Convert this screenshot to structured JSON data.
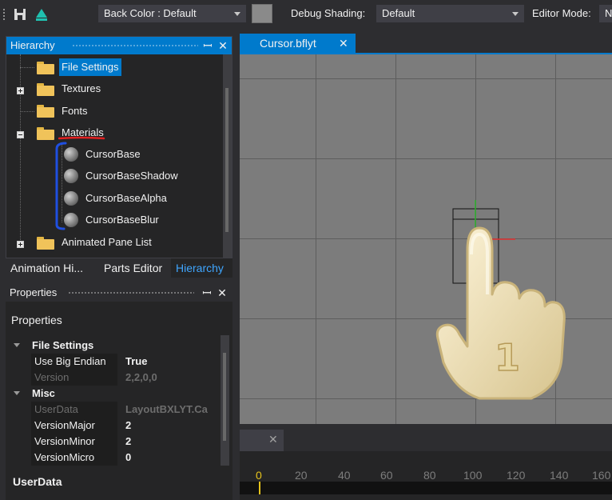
{
  "toolbar": {
    "back_color_label": "Back Color : Default",
    "debug_shading_label": "Debug Shading:",
    "debug_shading_value": "Default",
    "editor_mode_label": "Editor Mode:",
    "editor_mode_value": "N",
    "swatch_color": "#8a8a8a"
  },
  "hierarchy": {
    "title": "Hierarchy",
    "items": [
      {
        "label": "File Settings",
        "selected": true
      },
      {
        "label": "Textures"
      },
      {
        "label": "Fonts"
      },
      {
        "label": "Materials"
      },
      {
        "label": "CursorBase"
      },
      {
        "label": "CursorBaseShadow"
      },
      {
        "label": "CursorBaseAlpha"
      },
      {
        "label": "CursorBaseBlur"
      },
      {
        "label": "Animated Pane List"
      }
    ]
  },
  "left_tabs": [
    "Animation Hi...",
    "Parts Editor",
    "Hierarchy"
  ],
  "properties": {
    "title": "Properties",
    "header": "Properties",
    "categories": {
      "file_settings": "File Settings",
      "misc": "Misc",
      "userdata": "UserData"
    },
    "rows": [
      {
        "key": "Use Big Endian",
        "value": "True"
      },
      {
        "key": "Version",
        "value": "2,2,0,0"
      },
      {
        "key": "UserData",
        "value": "LayoutBXLYT.Ca"
      },
      {
        "key": "VersionMajor",
        "value": "2"
      },
      {
        "key": "VersionMinor",
        "value": "2"
      },
      {
        "key": "VersionMicro",
        "value": "0"
      }
    ]
  },
  "document": {
    "tab_title": "Cursor.bflyt",
    "close_glyph": "✕"
  },
  "timeline": {
    "close_glyph": "✕",
    "ticks": [
      "0",
      "20",
      "40",
      "60",
      "80",
      "100",
      "120",
      "140",
      "160"
    ]
  },
  "overlay": {
    "hand_number": "1"
  },
  "glyphs": {
    "pin": "ꟷ",
    "close": "✕"
  },
  "colors": {
    "accent": "#007acc",
    "active_tab_text": "#3fa6ff",
    "timeline_cursor": "#e6c31b",
    "annotation_red": "#e02020",
    "annotation_blue": "#1f4fe0"
  }
}
